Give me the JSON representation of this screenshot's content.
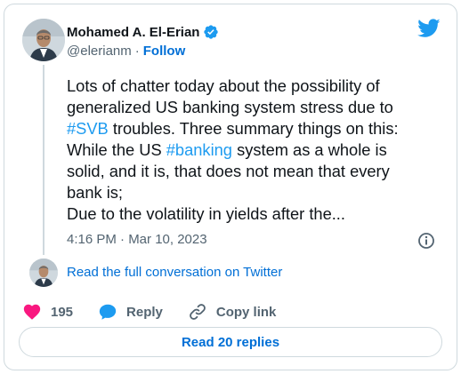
{
  "author": {
    "name": "Mohamed A. El-Erian",
    "handle": "@elerianm",
    "separator": "·",
    "follow_label": "Follow"
  },
  "tweet": {
    "lines": [
      [
        {
          "text": "Lots of chatter today about the possibility of"
        }
      ],
      [
        {
          "text": "generalized US banking system stress due to"
        }
      ],
      [
        {
          "text": "#SVB",
          "hashtag": true
        },
        {
          "text": " troubles. Three summary things on this:"
        }
      ],
      [
        {
          "text": "While the US "
        },
        {
          "text": "#banking",
          "hashtag": true
        },
        {
          "text": " system as a whole is"
        }
      ],
      [
        {
          "text": "solid, and it is, that does not mean that every"
        }
      ],
      [
        {
          "text": "bank is;"
        }
      ],
      [
        {
          "text": "Due to the volatility in yields after the..."
        }
      ]
    ],
    "timestamp": "4:16 PM · Mar 10, 2023"
  },
  "conversation": {
    "read_full_label": "Read the full conversation on Twitter"
  },
  "actions": {
    "like_count": "195",
    "reply_label": "Reply",
    "copy_link_label": "Copy link",
    "read_replies_label": "Read 20 replies"
  },
  "colors": {
    "accent": "#1d9bf0",
    "link": "#006fd6",
    "like": "#f91880",
    "muted": "#536471",
    "border": "#cfd9de"
  },
  "icons": {
    "brand": "twitter-bird-icon",
    "verified": "verified-badge-icon",
    "info": "info-icon",
    "like": "heart-icon",
    "reply": "speech-bubble-icon",
    "copy_link": "link-icon"
  }
}
